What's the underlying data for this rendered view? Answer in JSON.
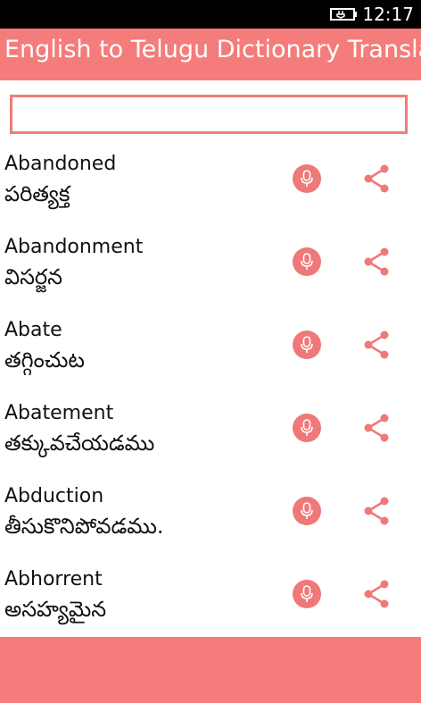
{
  "status_bar": {
    "time": "12:17"
  },
  "header": {
    "title": "English to Telugu Dictionary Translator"
  },
  "search": {
    "value": "",
    "placeholder": ""
  },
  "entries": [
    {
      "word": "Abandoned",
      "meaning": "పరిత్యక్త"
    },
    {
      "word": "Abandonment",
      "meaning": "విసర్జన"
    },
    {
      "word": "Abate",
      "meaning": "తగ్గించుట"
    },
    {
      "word": "Abatement",
      "meaning": "తక్కువచేయడము"
    },
    {
      "word": "Abduction",
      "meaning": "తీసుకొనిపోవడము."
    },
    {
      "word": "Abhorrent",
      "meaning": "అసహ్యమైన"
    }
  ],
  "icons": {
    "speak": "microphone-icon",
    "share": "share-icon",
    "status": "battery-charging-icon"
  },
  "colors": {
    "accent": "#f47c7a",
    "status_bar": "#000000",
    "background": "#ffffff"
  }
}
